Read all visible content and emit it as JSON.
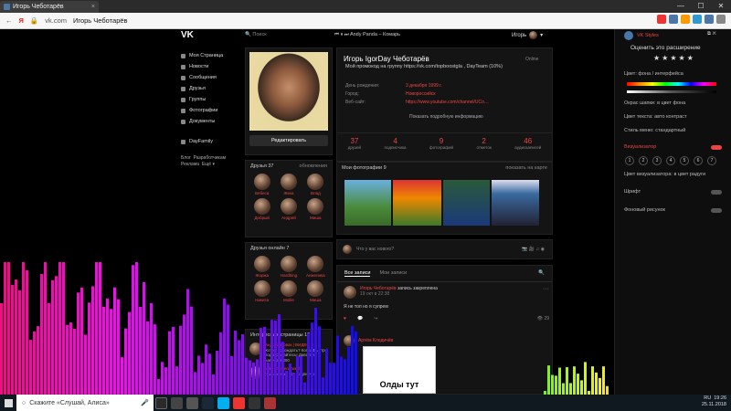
{
  "browser": {
    "tab_title": "Игорь Чеботарёв",
    "url": "vk.com",
    "page_title": "Игорь Чеботарёв",
    "window_controls": [
      "—",
      "☐",
      "✕"
    ]
  },
  "vk": {
    "logo": "VK",
    "search_placeholder": "Поиск",
    "player": "Andy Panda – Комарь",
    "user_name": "Игорь",
    "nav": [
      "Моя Страница",
      "Новости",
      "Сообщения",
      "Друзья",
      "Группы",
      "Фотографии",
      "Документы",
      "DayFamily"
    ],
    "footer": "Блог  Разработчикам\nРеклама  Ещё ▾",
    "edit_button": "Редактировать",
    "friends": {
      "title": "Друзья  37",
      "link": "обновления",
      "names": [
        "Бебеса",
        "Жека",
        "Влад",
        "Добрый",
        "Андрей",
        "Миша"
      ]
    },
    "online": {
      "title": "Друзья онлайн  7",
      "names": [
        "Жоржа",
        "Hardbing",
        "Анжелика",
        "Никита",
        "Mollie",
        "Миша"
      ]
    },
    "interest": {
      "title": "Интересные страницы  12",
      "pages": [
        {
          "name": "Андрей Новак | ВИДЕО",
          "desc": "Хотел подождать? Когда Быстро подписывайтесь! Давайте наберем 800"
        },
        {
          "name": "Mike Vanden Twerlo",
          "desc": "Наша цель: 700 подписчи"
        }
      ]
    },
    "profile": {
      "name": "Игорь IgorDay Чеботарёв",
      "status": "Мой промокод на группу https://vk.com/topboostgla , DayTeam (10%)",
      "online": "Online",
      "info": [
        {
          "k": "День рождения:",
          "v": "3 декабря 1999 г."
        },
        {
          "k": "Город:",
          "v": "Новороссийск"
        },
        {
          "k": "Веб-сайт:",
          "v": "https://www.youtube.com/channel/UCo…"
        }
      ],
      "more": "Показать подробную информацию",
      "counters": [
        {
          "n": "37",
          "l": "друзей"
        },
        {
          "n": "4",
          "l": "подписчика"
        },
        {
          "n": "9",
          "l": "фотографий"
        },
        {
          "n": "2",
          "l": "отметок"
        },
        {
          "n": "46",
          "l": "аудиозаписей"
        }
      ]
    },
    "photos": {
      "title": "Мои фотографии  9",
      "link": "показать на карте"
    },
    "new_post": "Что у вас нового?",
    "wall": {
      "tab_all": "Все записи",
      "tab_mine": "Мои записи",
      "post1_author": "Игорь Чеботарёв",
      "post1_action": "запись закреплена",
      "post1_time": "19 окт в 22:38",
      "post1_text": "Я не топ но я супрем",
      "post1_views": "29",
      "post2_author": "Артём Клодичёв",
      "meme_text": "Олды тут"
    }
  },
  "panel": {
    "user": "VK Styles",
    "rate": "Оценить это расширение",
    "stars": "★★★★★",
    "color_label": "Цвет: фона / интерфейса",
    "items": [
      "Окрас шапки: в цвет фона",
      "Цвет текста: авто контраст",
      "Стиль меню: стандартный"
    ],
    "visualizer": "Визуализатор",
    "nums": [
      "1",
      "2",
      "3",
      "4",
      "5",
      "6",
      "7"
    ],
    "vis_color": "Цвет визуализатора: в цвет радуги",
    "font": "Шрифт",
    "bg": "Фоновый рисунок"
  },
  "taskbar": {
    "cortana": "Скажите «Слушай, Алиса»",
    "lang": "RU",
    "time": "19:26",
    "date": "25.11.2018"
  }
}
